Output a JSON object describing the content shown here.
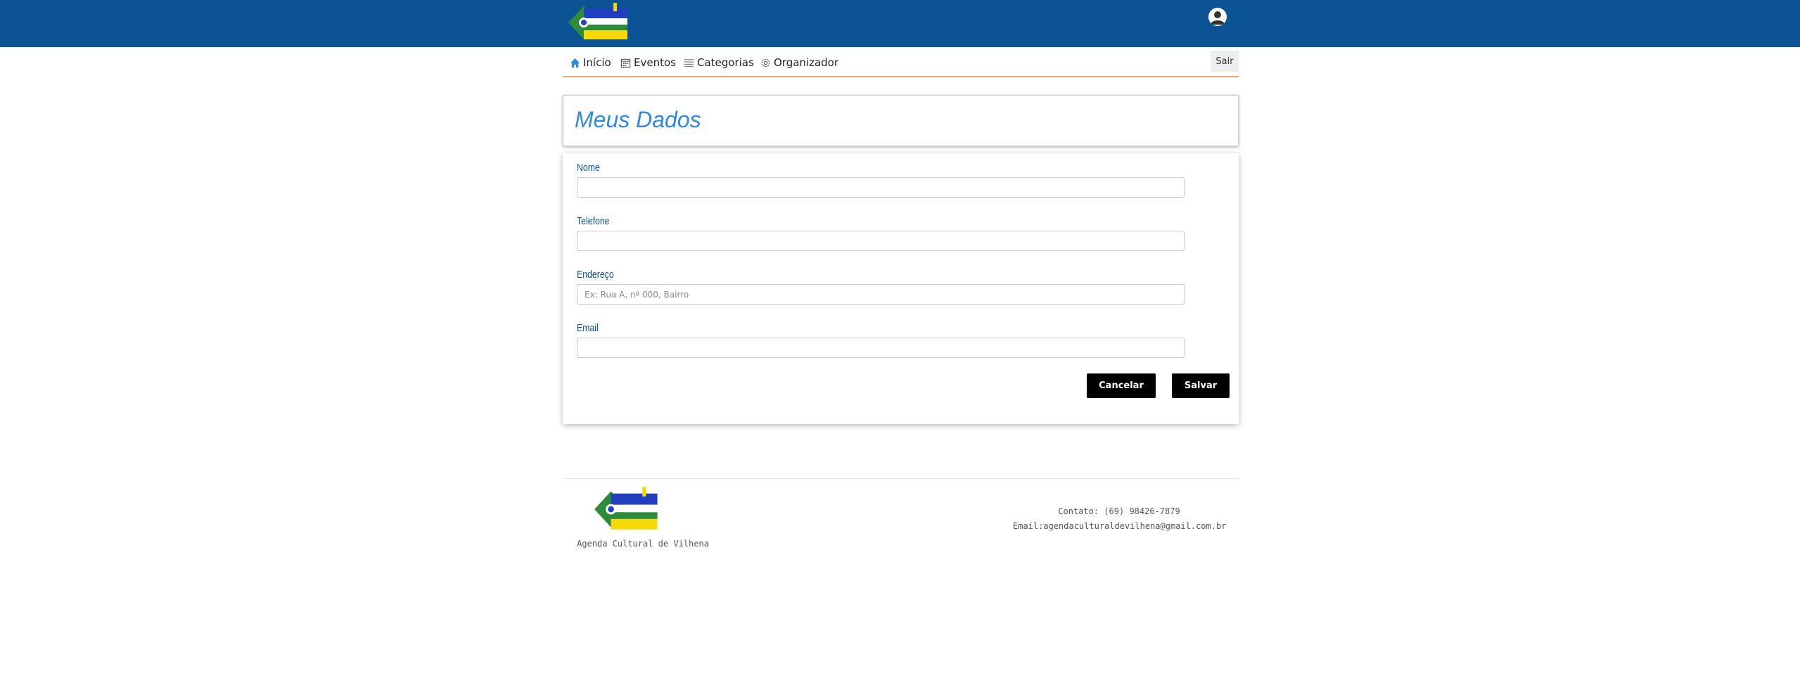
{
  "brand": {
    "logo_alt": "Agenda Cultural de Vilhena",
    "colors": {
      "header": "#0b5394",
      "accent": "#2d89e5",
      "nav_underline": "#f4a582",
      "logo_green": "#2e8b3a",
      "logo_yellow": "#f5d90a",
      "logo_blue": "#1f3fbf"
    }
  },
  "nav": {
    "items": [
      {
        "label": "Início",
        "icon": "home-icon"
      },
      {
        "label": "Eventos",
        "icon": "calendar-icon"
      },
      {
        "label": "Categorias",
        "icon": "list-icon"
      },
      {
        "label": "Organizador",
        "icon": "gear-icon"
      }
    ],
    "logout_label": "Sair"
  },
  "page": {
    "title": "Meus Dados"
  },
  "form": {
    "fields": [
      {
        "label": "Nome",
        "value": "",
        "placeholder": ""
      },
      {
        "label": "Telefone",
        "value": "",
        "placeholder": ""
      },
      {
        "label": "Endereço",
        "value": "",
        "placeholder": "Ex: Rua A, nº 000, Bairro"
      },
      {
        "label": "Email",
        "value": "",
        "placeholder": ""
      }
    ],
    "cancel_label": "Cancelar",
    "save_label": "Salvar"
  },
  "footer": {
    "name": "Agenda Cultural de Vilhena",
    "contact": "Contato: (69) 98426-7879",
    "email": "Email:agendaculturaldevilhena@gmail.com.br"
  }
}
